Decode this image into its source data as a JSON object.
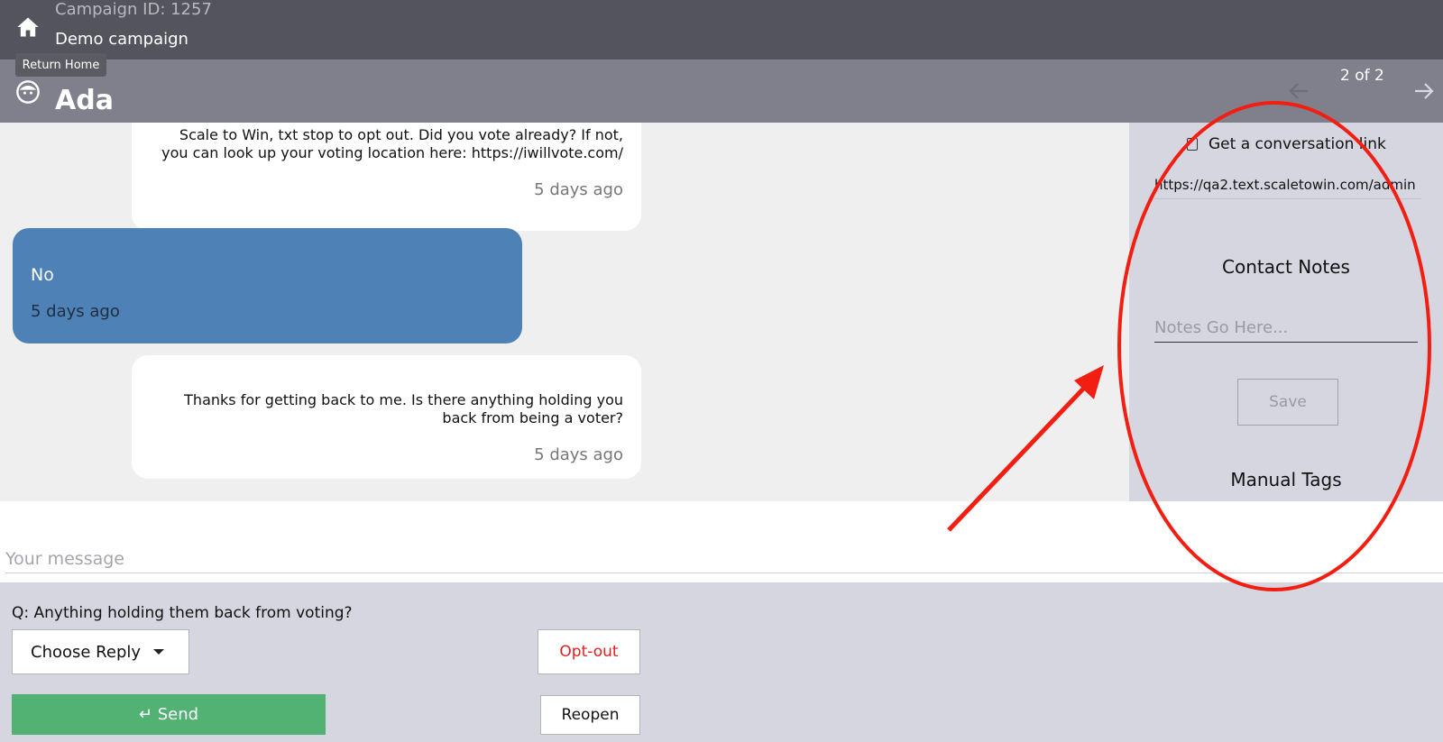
{
  "header": {
    "campaign_id": "Campaign ID: 1257",
    "campaign_name": "Demo campaign",
    "tooltip": "Return Home"
  },
  "contact": {
    "name": "Ada",
    "pager": "2 of 2"
  },
  "messages": [
    {
      "direction": "outgoing",
      "text": "Scale to Win, txt stop to opt out. Did you vote already? If not, you can look up your voting location here: https://iwillvote.com/",
      "time": "5 days ago"
    },
    {
      "direction": "incoming",
      "text": "No",
      "time": "5 days ago"
    },
    {
      "direction": "outgoing",
      "text": "Thanks for getting back to me. Is there anything holding you back from being a voter?",
      "time": "5 days ago"
    }
  ],
  "sidebar": {
    "conversation_link_label": "Get a conversation link",
    "conversation_url": "https://qa2.text.scaletowin.com/admin",
    "contact_notes_title": "Contact Notes",
    "notes_placeholder": "Notes Go Here...",
    "save_label": "Save",
    "manual_tags_title": "Manual Tags"
  },
  "composer": {
    "placeholder": "Your message"
  },
  "bottom": {
    "question": "Q: Anything holding them back from voting?",
    "choose_reply_label": "Choose Reply",
    "optout_label": "Opt-out",
    "send_label": "↵ Send",
    "reopen_label": "Reopen"
  },
  "colors": {
    "topbar": "#54545e",
    "contactbar": "#80808c",
    "incoming_bubble": "#4e81b5",
    "send_button": "#52b273",
    "optout_text": "#e02020",
    "annotation": "#f21e12"
  },
  "icons": {
    "home": "home-icon",
    "contact": "face-icon",
    "previous": "arrow-left-icon",
    "next": "arrow-right-icon",
    "dropdown": "caret-down-icon"
  }
}
